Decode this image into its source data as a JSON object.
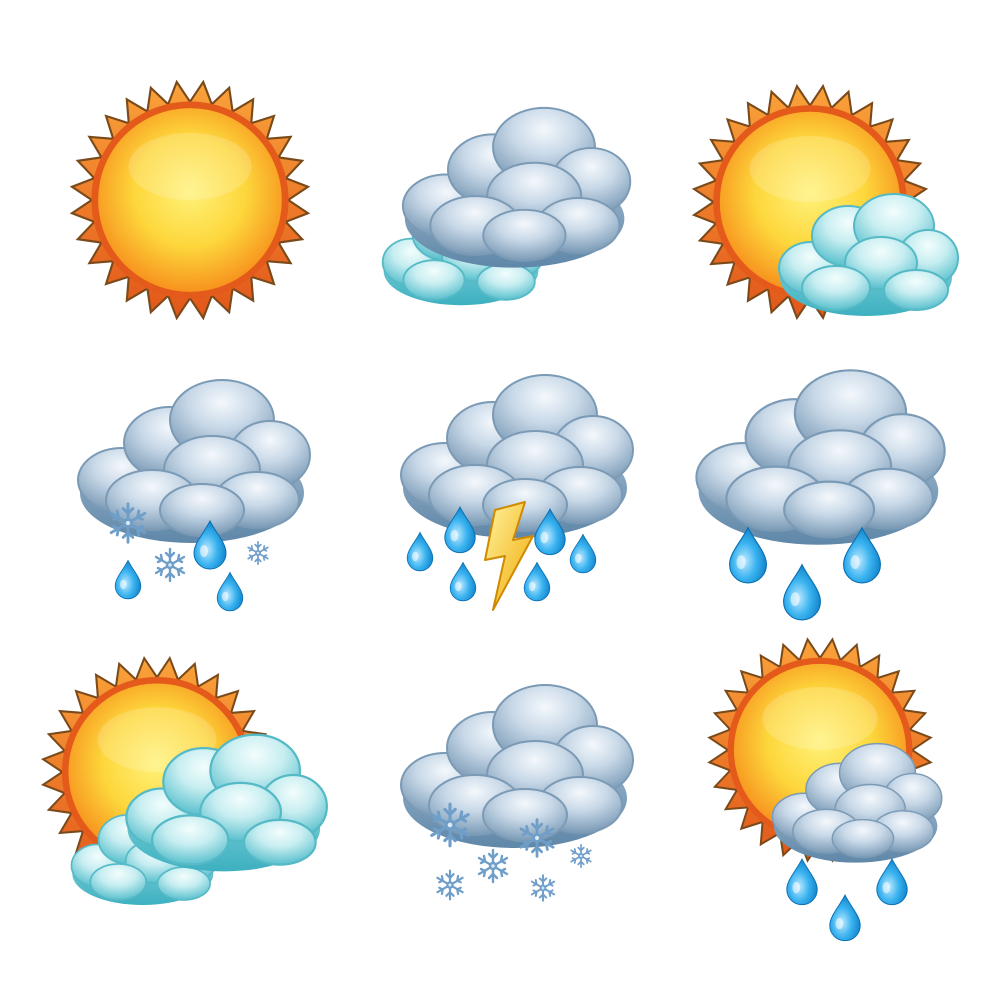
{
  "icons": [
    {
      "name": "sunny-icon",
      "elements": [
        "sun-icon"
      ]
    },
    {
      "name": "cloudy-icon",
      "elements": [
        "cloud-icon",
        "cloud-icon"
      ]
    },
    {
      "name": "partly-sunny-icon",
      "elements": [
        "sun-icon",
        "cloud-icon"
      ]
    },
    {
      "name": "snow-rain-icon",
      "elements": [
        "cloud-icon",
        "snowflake-icon",
        "raindrop-icon"
      ]
    },
    {
      "name": "thunderstorm-icon",
      "elements": [
        "cloud-icon",
        "lightning-icon",
        "raindrop-icon"
      ]
    },
    {
      "name": "rain-icon",
      "elements": [
        "cloud-icon",
        "raindrop-icon"
      ]
    },
    {
      "name": "mostly-cloudy-icon",
      "elements": [
        "sun-icon",
        "cloud-icon",
        "cloud-icon"
      ]
    },
    {
      "name": "snow-icon",
      "elements": [
        "cloud-icon",
        "snowflake-icon"
      ]
    },
    {
      "name": "sun-shower-icon",
      "elements": [
        "sun-icon",
        "cloud-icon",
        "raindrop-icon"
      ]
    }
  ],
  "colors": {
    "background": "#ffffff",
    "sun_core": "#fde34a",
    "sun_edge": "#f7931e",
    "sun_rays": "#f26b1d",
    "sun_ray_outline": "#7a4a1a",
    "storm_cloud_light": "#e3edf6",
    "storm_cloud_dark": "#7d9cb7",
    "light_cloud": "#9fdde4",
    "light_cloud_dark": "#48b9c7",
    "raindrop": "#2aa7e8",
    "lightning": "#f6c21c",
    "snowflake": "#6f9ec9"
  }
}
